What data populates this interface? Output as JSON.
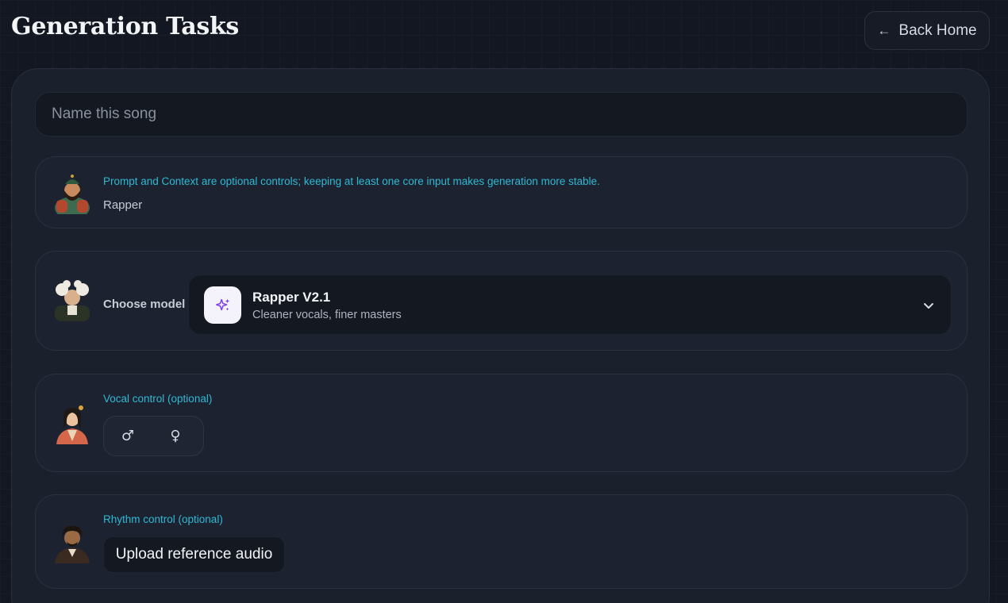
{
  "header": {
    "title": "Generation Tasks",
    "back_label": "Back Home",
    "back_icon": "arrow-left-icon"
  },
  "form": {
    "song_name": {
      "value": "",
      "placeholder": "Name this song"
    },
    "prompt_card": {
      "hint": "Prompt and Context are optional controls; keeping at least one core input makes generation more stable.",
      "persona": "Rapper"
    },
    "model_card": {
      "label": "Choose model",
      "selected_name": "Rapper V2.1",
      "selected_desc": "Cleaner vocals, finer masters",
      "icon": "sparkles-icon"
    },
    "vocal_card": {
      "hint": "Vocal control (optional)",
      "options": [
        "♂",
        "♀"
      ]
    },
    "rhythm_card": {
      "hint": "Rhythm control (optional)",
      "upload_label": "Upload reference audio"
    }
  },
  "colors": {
    "accent": "#2fb9d3",
    "background": "#121722",
    "panel": "#1a202c",
    "sparkle": "#7c3aed"
  }
}
